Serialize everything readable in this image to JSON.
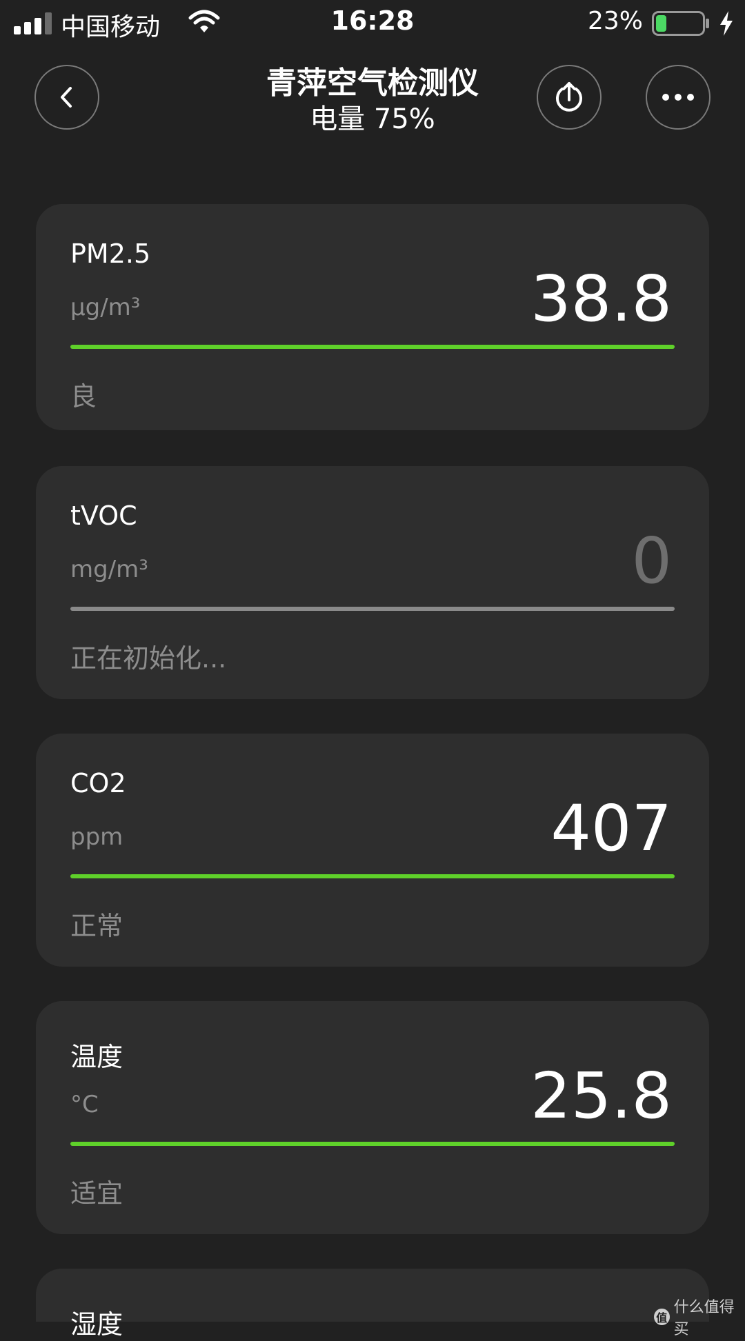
{
  "status_bar": {
    "carrier": "中国移动",
    "time": "16:28",
    "battery_percent": "23%",
    "battery_level": 0.23,
    "icons": [
      "signal-icon",
      "wifi-icon",
      "battery-icon",
      "charging-bolt-icon"
    ]
  },
  "nav": {
    "title": "青萍空气检测仪",
    "subtitle": "电量 75%",
    "icons": [
      "back-chevron-icon",
      "share-upload-icon",
      "more-dots-icon"
    ]
  },
  "metrics": [
    {
      "name": "PM2.5",
      "unit": "µg/m³",
      "value": "38.8",
      "status": "良",
      "bar_state": "active",
      "bar_color": "#5fd12a"
    },
    {
      "name": "tVOC",
      "unit": "mg/m³",
      "value": "0",
      "status": "正在初始化...",
      "bar_state": "inactive",
      "bar_color": "#8a8a8a"
    },
    {
      "name": "CO2",
      "unit": "ppm",
      "value": "407",
      "status": "正常",
      "bar_state": "active",
      "bar_color": "#5fd12a"
    },
    {
      "name": "温度",
      "unit": "°C",
      "value": "25.8",
      "status": "适宜",
      "bar_state": "active",
      "bar_color": "#5fd12a"
    },
    {
      "name": "湿度"
    }
  ],
  "watermark": {
    "text": "什么值得买",
    "logo_text": "值"
  },
  "colors": {
    "background": "#212121",
    "card": "#2e2e2e",
    "accent_green": "#5fd12a",
    "muted_text": "#8d8d8d"
  }
}
